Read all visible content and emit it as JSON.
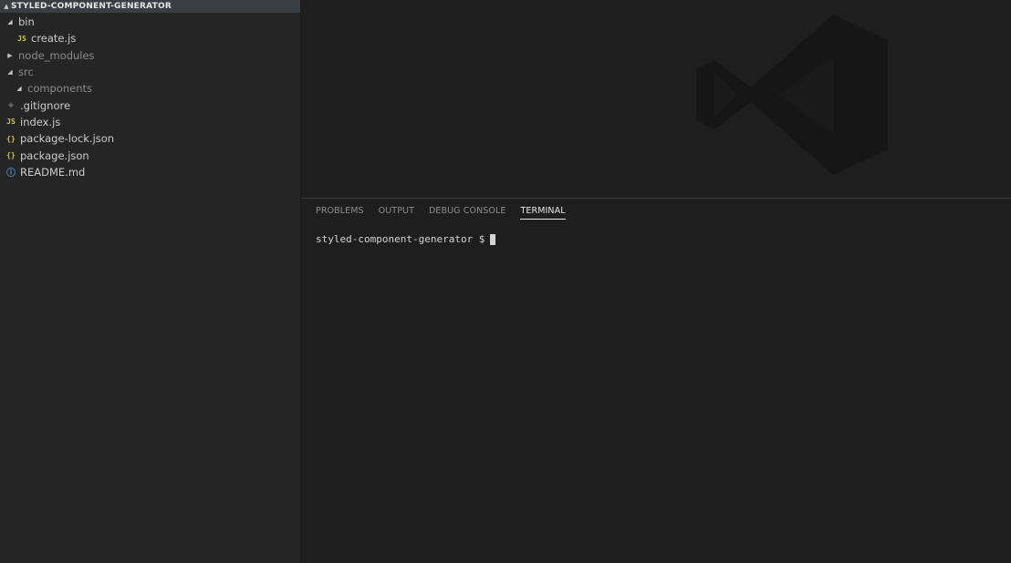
{
  "explorer": {
    "title": "STYLED-COMPONENT-GENERATOR",
    "items": [
      {
        "label": "bin"
      },
      {
        "label": "create.js"
      },
      {
        "label": "node_modules"
      },
      {
        "label": "src"
      },
      {
        "label": "components"
      },
      {
        "label": ".gitignore"
      },
      {
        "label": "index.js"
      },
      {
        "label": "package-lock.json"
      },
      {
        "label": "package.json"
      },
      {
        "label": "README.md"
      }
    ]
  },
  "panel": {
    "tabs": [
      {
        "label": "PROBLEMS"
      },
      {
        "label": "OUTPUT"
      },
      {
        "label": "DEBUG CONSOLE"
      },
      {
        "label": "TERMINAL"
      }
    ],
    "active_tab": "TERMINAL"
  },
  "terminal": {
    "prompt": "styled-component-generator $"
  },
  "icons": {
    "expanded": "chevron-down-icon",
    "collapsed": "chevron-right-icon",
    "js": "js-file-icon",
    "json": "json-file-icon",
    "git": "git-file-icon",
    "info": "info-icon",
    "watermark": "vscode-logo-icon"
  },
  "colors": {
    "sidebar_bg": "#252526",
    "editor_bg": "#1e1e1e",
    "js_accent": "#cbcb41",
    "info_accent": "#519aba"
  }
}
